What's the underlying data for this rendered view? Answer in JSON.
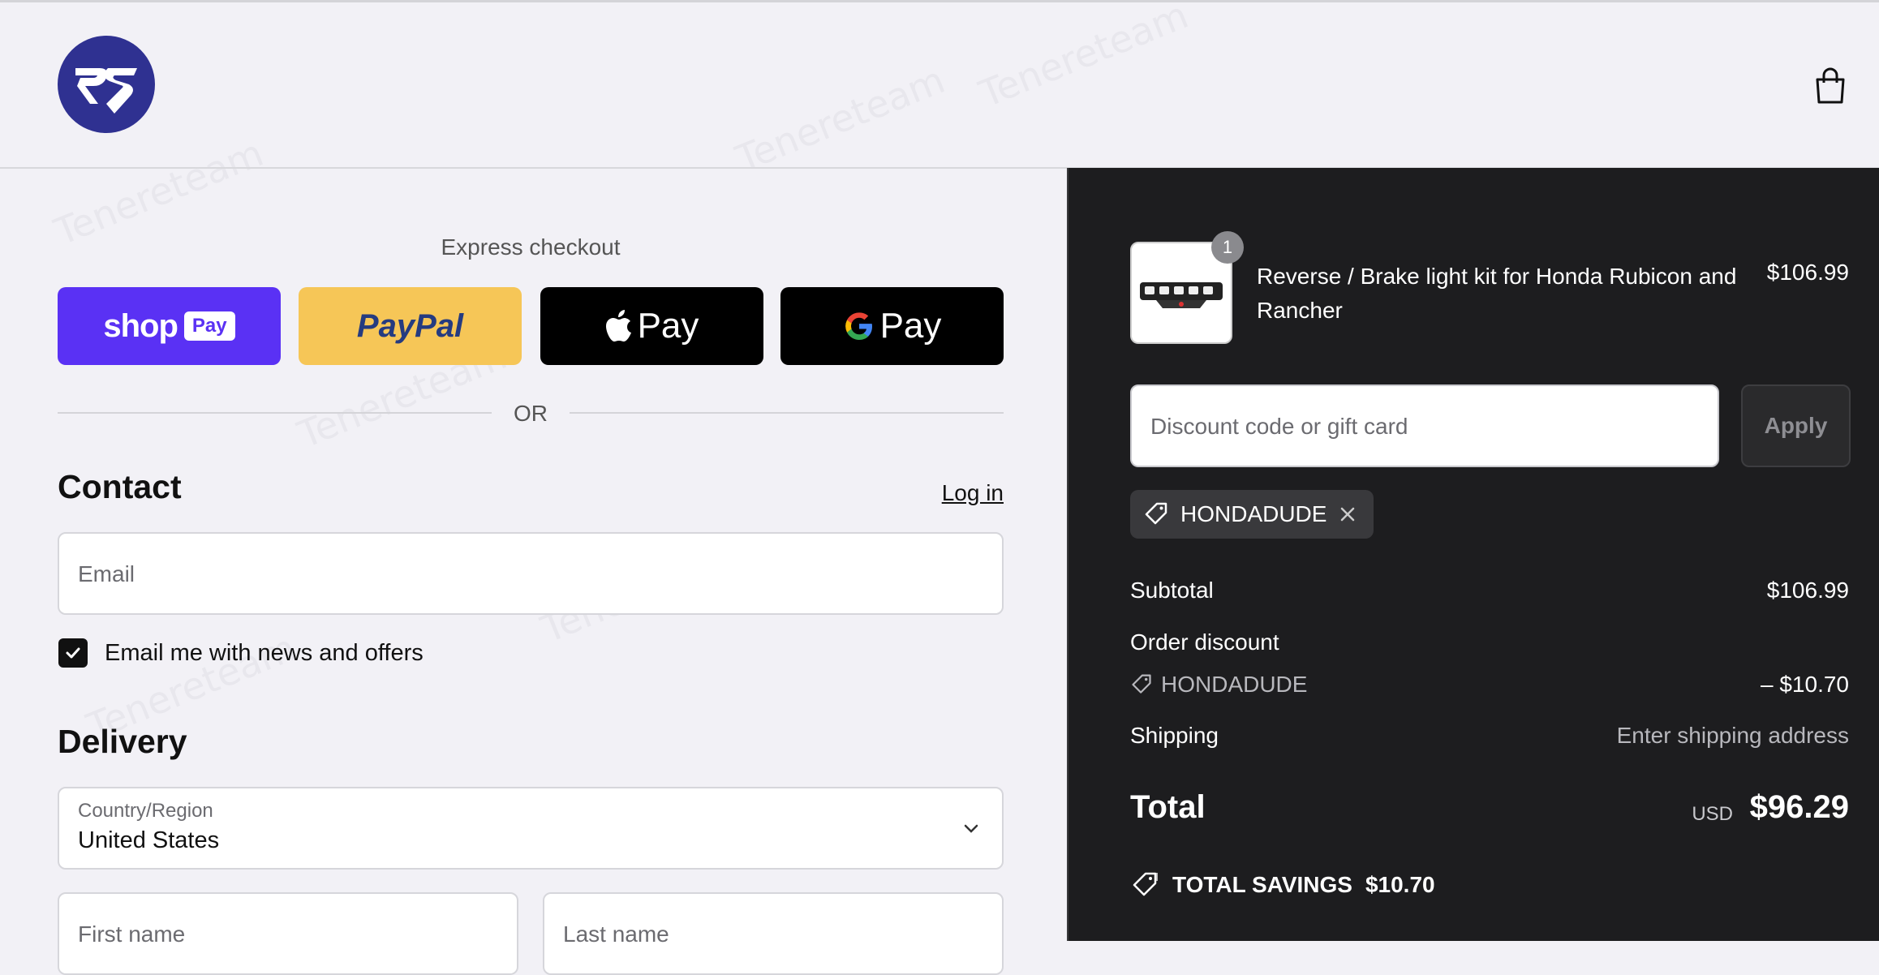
{
  "watermark": {
    "text": "Tenereteam"
  },
  "header": {
    "logo": "RS",
    "cart_icon": "shopping-bag-icon"
  },
  "express": {
    "title": "Express checkout",
    "shop_pay": {
      "brand": "shop",
      "badge": "Pay"
    },
    "paypal": {
      "label": "PayPal"
    },
    "apple_pay": {
      "label": "Pay"
    },
    "google_pay": {
      "label": "Pay"
    },
    "divider": "OR"
  },
  "contact": {
    "title": "Contact",
    "login_link": "Log in",
    "email_placeholder": "Email",
    "newsletter_label": "Email me with news and offers",
    "newsletter_checked": true
  },
  "delivery": {
    "title": "Delivery",
    "country_label": "Country/Region",
    "country_value": "United States",
    "first_name_placeholder": "First name",
    "last_name_placeholder": "Last name"
  },
  "summary": {
    "product": {
      "name": "Reverse / Brake light kit for Honda Rubicon and Rancher",
      "price": "$106.99",
      "quantity": "1"
    },
    "discount_placeholder": "Discount code or gift card",
    "apply_label": "Apply",
    "applied_code": "HONDADUDE",
    "subtotal_label": "Subtotal",
    "subtotal_value": "$106.99",
    "order_discount_label": "Order discount",
    "discount_code": "HONDADUDE",
    "discount_value": "– $10.70",
    "shipping_label": "Shipping",
    "shipping_value": "Enter shipping address",
    "total_label": "Total",
    "total_currency": "USD",
    "total_value": "$96.29",
    "savings_label": "TOTAL SAVINGS",
    "savings_value": "$10.70"
  },
  "colors": {
    "shop_pay": "#5a31f4",
    "paypal": "#f6c657",
    "summary_bg": "#1d1d1f",
    "logo": "#2f3191"
  }
}
